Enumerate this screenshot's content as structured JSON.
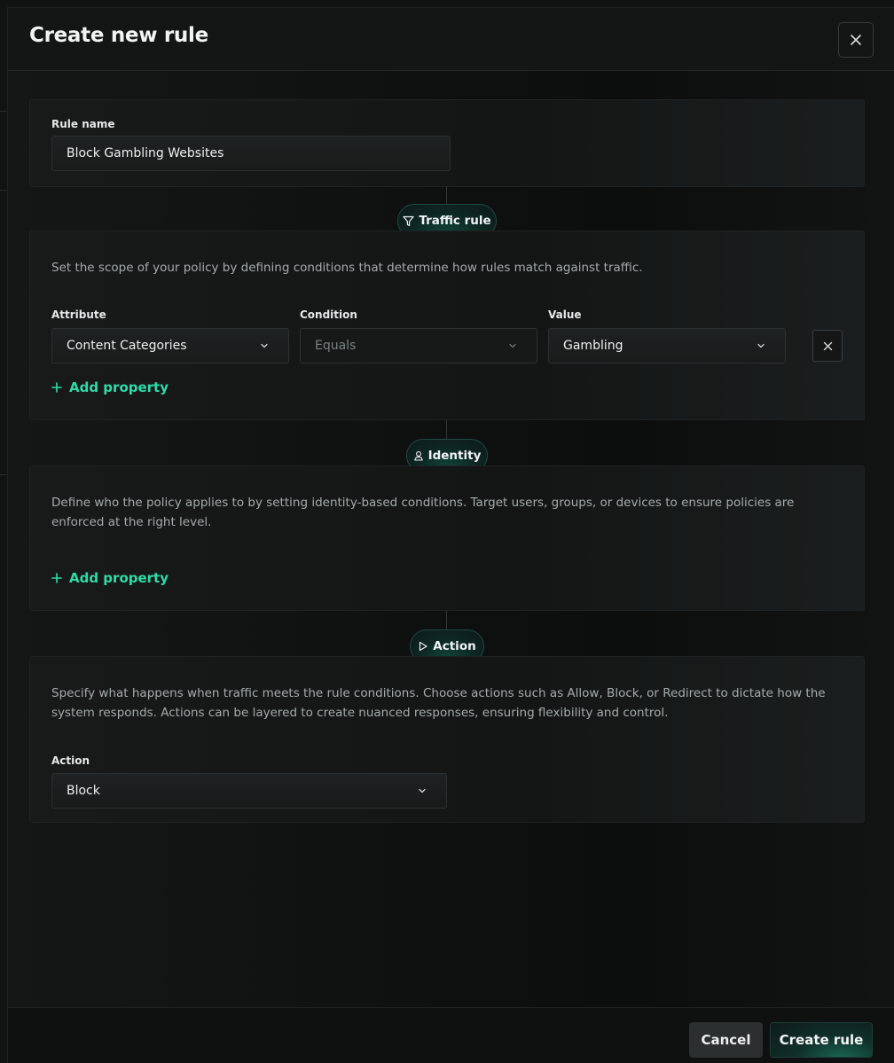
{
  "modal": {
    "title": "Create new rule",
    "close_icon": "close-icon"
  },
  "rule_name": {
    "label": "Rule name",
    "value": "Block Gambling Websites"
  },
  "traffic": {
    "badge": "Traffic rule",
    "badge_icon": "filter-icon",
    "description": "Set the scope of your policy by defining conditions that determine how rules match against traffic.",
    "attribute_label": "Attribute",
    "attribute_value": "Content Categories",
    "condition_label": "Condition",
    "condition_value": "Equals",
    "value_label": "Value",
    "value_value": "Gambling",
    "add_property": "Add property"
  },
  "identity": {
    "badge": "Identity",
    "badge_icon": "user-icon",
    "description": "Define who the policy applies to by setting identity-based conditions. Target users, groups, or devices to ensure policies are enforced at the right level.",
    "add_property": "Add property"
  },
  "action": {
    "badge": "Action",
    "badge_icon": "play-icon",
    "description": "Specify what happens when traffic meets the rule conditions. Choose actions such as Allow, Block, or Redirect to dictate how the system responds. Actions can be layered to create nuanced responses, ensuring flexibility and control.",
    "action_label": "Action",
    "action_value": "Block"
  },
  "footer": {
    "cancel": "Cancel",
    "create": "Create rule"
  },
  "colors": {
    "accent": "#2fdca6",
    "background": "#0f1111"
  }
}
